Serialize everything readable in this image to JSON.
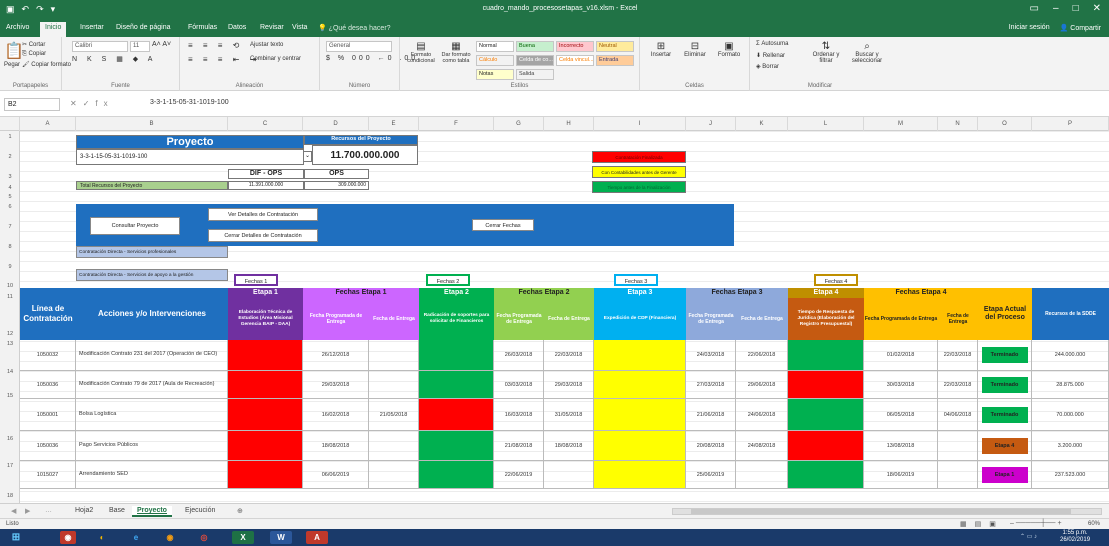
{
  "window": {
    "title": "cuadro_mando_procesosetapas_v16.xlsm - Excel",
    "qat_icons": [
      "save-icon",
      "undo-icon",
      "redo-icon",
      "customize-icon"
    ]
  },
  "ribbon_tabs": [
    "Archivo",
    "Inicio",
    "Insertar",
    "Diseño de página",
    "Fórmulas",
    "Datos",
    "Revisar",
    "Vista"
  ],
  "tell_me": "¿Qué desea hacer?",
  "user": {
    "signin": "Iniciar sesión",
    "share": "Compartir"
  },
  "ribbon": {
    "clipboard": {
      "label": "Portapapeles",
      "paste": "Pegar",
      "cut": "Cortar",
      "copy": "Copiar",
      "format_painter": "Copiar formato"
    },
    "font": {
      "label": "Fuente",
      "name": "Calibri",
      "size": "11"
    },
    "alignment": {
      "label": "Alineación",
      "wrap": "Ajustar texto",
      "merge": "Combinar y centrar"
    },
    "number": {
      "label": "Número",
      "format": "General"
    },
    "styles": {
      "label": "Estilos",
      "conditional": "Formato condicional",
      "table": "Dar formato como tabla",
      "cells": [
        "Normal",
        "Buena",
        "Incorrecto",
        "Neutral",
        "Cálculo",
        "Celda de co...",
        "Celda vincul...",
        "Entrada",
        "Notas",
        "Salida"
      ]
    },
    "cells": {
      "label": "Celdas",
      "insert": "Insertar",
      "delete": "Eliminar",
      "format": "Formato"
    },
    "editing": {
      "label": "Modificar",
      "autosum": "Autosuma",
      "fill": "Rellenar",
      "clear": "Borrar",
      "sort": "Ordenar y filtrar",
      "find": "Buscar y seleccionar"
    }
  },
  "formula_bar": {
    "name_box": "B2",
    "formula": "3-3-1-15-05-31-1019-100"
  },
  "columns": [
    "A",
    "B",
    "C",
    "D",
    "E",
    "F",
    "G",
    "H",
    "I",
    "J",
    "K",
    "L",
    "M",
    "N",
    "O",
    "P"
  ],
  "rows": [
    "1",
    "2",
    "3",
    "4",
    "5",
    "6",
    "7",
    "8",
    "9",
    "10",
    "11",
    "12",
    "13",
    "14",
    "15",
    "16",
    "17",
    "18"
  ],
  "top": {
    "proyecto_title": "Proyecto",
    "proyecto_value": "3-3-1-15-05-31-1019-100",
    "recursos_label": "Recursos del Proyecto",
    "recursos_value": "11.700.000.000",
    "dif_ops_label": "DIF - OPS",
    "ops_label": "OPS",
    "total_label": "Total Recursos del Proyecto",
    "dif_ops_value": "11.391.000.000",
    "ops_value": "309.000.000",
    "legend": [
      {
        "text": "Contratación Finalizada",
        "color": "#ff0000"
      },
      {
        "text": "Con Contabilidades antes de Gerente",
        "color": "#ffff00"
      },
      {
        "text": "Tiempo antes de la Finalización",
        "color": "#00b050"
      }
    ],
    "btn_consultar": "Consultar Proyecto",
    "btn_detalles": "Ver Detalles de Contratación",
    "btn_cerrar": "Cerrar Detalles de Contratación",
    "btn_cerrar_fechas": "Cerrar Fechas",
    "info1": "Contratación Directa - Servicios profesionales",
    "info2": "Contratación Directa - Servicios de apoyo a la gestión",
    "fechas_buttons": [
      "Fechas 1",
      "Fechas 2",
      "Fechas 3",
      "Fechas 4"
    ]
  },
  "table": {
    "headers": {
      "linea": "Línea de Contratación",
      "acciones": "Acciones y/o Intervenciones",
      "etapa1": "Etapa 1",
      "etapa1_sub": "Elaboración Técnica de Estudios (Área Misional Gerencia BAIP - DAA)",
      "fechas1": "Fechas Etapa 1",
      "prog1": "Fecha Programada de Entrega",
      "ent1": "Fecha de Entrega",
      "etapa2": "Etapa 2",
      "etapa2_sub": "Radicación de soportes para solicitar de Financieros",
      "fechas2": "Fechas Etapa 2",
      "prog2": "Fecha Programada de Entrega",
      "ent2": "Fecha de Entrega",
      "etapa3": "Etapa 3",
      "etapa3_sub": "Expedición de CDP (Financiera)",
      "fechas3": "Fechas Etapa 3",
      "prog3": "Fecha Programada de Entrega",
      "ent3": "Fecha de Entrega",
      "etapa4": "Etapa 4",
      "etapa4_sub": "Tiempo de Respuesta de Jurídica (Elaboración del Registro Presupuestal)",
      "fechas4": "Fechas Etapa 4",
      "prog4": "Fecha Programada de Entrega",
      "ent4": "Fecha de Entrega",
      "actual": "Etapa Actual del Proceso",
      "recursos": "Recursos de la SDDE"
    },
    "rows": [
      {
        "linea": "1050032",
        "accion": "Modificación Contrato 231 del 2017 (Operación de CEO)",
        "e1": "#ff0000",
        "p1": "26/12/2018",
        "n1": "",
        "e2": "#00b050",
        "p2": "26/03/2018",
        "n2": "22/03/2018",
        "e3": "#ffff00",
        "p3": "24/03/2018",
        "n3": "22/06/2018",
        "e4": "#00b050",
        "p4": "01/02/2018",
        "n4": "22/03/2018",
        "actual": "Terminado",
        "actual_color": "#00b050",
        "recursos": "244.000.000"
      },
      {
        "linea": "1050036",
        "accion": "Modificación Contrato 79 de 2017 (Aula de Recreación)",
        "e1": "#ff0000",
        "p1": "29/03/2018",
        "n1": "",
        "e2": "#00b050",
        "p2": "03/03/2018",
        "n2": "29/03/2018",
        "e3": "#ffff00",
        "p3": "27/03/2018",
        "n3": "29/06/2018",
        "e4": "#ff0000",
        "p4": "30/03/2018",
        "n4": "22/03/2018",
        "actual": "Terminado",
        "actual_color": "#00b050",
        "recursos": "28.875.000"
      },
      {
        "linea": "1050001",
        "accion": "Bolsa Logística",
        "e1": "#ff0000",
        "p1": "16/02/2018",
        "n1": "21/05/2018",
        "e2": "#ff0000",
        "p2": "16/03/2018",
        "n2": "31/05/2018",
        "e3": "#ffff00",
        "p3": "21/06/2018",
        "n3": "24/06/2018",
        "e4": "#00b050",
        "p4": "06/05/2018",
        "n4": "04/06/2018",
        "actual": "Terminado",
        "actual_color": "#00b050",
        "recursos": "70.000.000"
      },
      {
        "linea": "1050036",
        "accion": "Pago Servicios Públicos",
        "e1": "#ff0000",
        "p1": "18/08/2018",
        "n1": "",
        "e2": "#00b050",
        "p2": "21/08/2018",
        "n2": "18/08/2018",
        "e3": "#ffff00",
        "p3": "20/08/2018",
        "n3": "24/08/2018",
        "e4": "#ff0000",
        "p4": "13/08/2018",
        "n4": "",
        "actual": "Etapa 4",
        "actual_color": "#c55a11",
        "recursos": "3.200.000"
      },
      {
        "linea": "1015027",
        "accion": "Arrendamiento SED",
        "e1": "#ff0000",
        "p1": "06/06/2019",
        "n1": "",
        "e2": "#00b050",
        "p2": "22/06/2019",
        "n2": "",
        "e3": "#ffff00",
        "p3": "25/06/2019",
        "n3": "",
        "e4": "#00b050",
        "p4": "18/06/2019",
        "n4": "",
        "actual": "Etapa 1",
        "actual_color": "#cc00cc",
        "recursos": "237.523.000"
      }
    ]
  },
  "sheet_tabs": [
    "Hoja2",
    "Base",
    "Proyecto",
    "Ejecución"
  ],
  "active_sheet": "Proyecto",
  "status": {
    "ready": "Listo",
    "zoom": "60%"
  },
  "taskbar": {
    "time": "1:55 p.m.",
    "date": "26/02/2019"
  }
}
